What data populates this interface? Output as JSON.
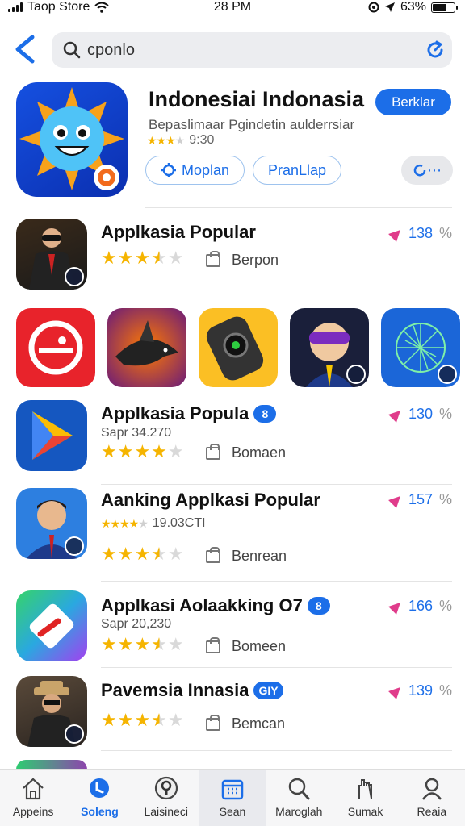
{
  "status_bar": {
    "carrier": "Taop Store",
    "time": "28 PM",
    "battery": "63%"
  },
  "search": {
    "query": "cponlo"
  },
  "featured": {
    "title": "Indonesiai Indonasia",
    "subtitle": "Bepaslimaar Pgindetin aulderrsiar",
    "stars_filled": 3,
    "rating_text": "9:30",
    "get_label": "Berklar",
    "pill1_label": "Moplan",
    "pill2_label": "PranLlap",
    "more_label": "⋯"
  },
  "apps": [
    {
      "name": "Applkasia Popular",
      "badge": "",
      "meta": "",
      "stars_filled": 3.5,
      "category": "Berpon",
      "percent": "138",
      "percent_symbol": "%"
    },
    {
      "name": "Applkasia Popula",
      "badge": "8",
      "meta": "Sapr 34.270",
      "stars_filled": 4,
      "category": "Bomaen",
      "percent": "130",
      "percent_symbol": "%"
    },
    {
      "name": "Aanking Applkasi Popular",
      "badge": "",
      "meta": "19.03CTI",
      "stars_filled": 3.5,
      "category": "Benrean",
      "percent": "157",
      "percent_symbol": "%"
    },
    {
      "name": "Applkasi Aolaakking O7",
      "badge": "8",
      "meta": "Sapr 20,230",
      "stars_filled": 3.5,
      "category": "Bomeen",
      "percent": "166",
      "percent_symbol": "%"
    },
    {
      "name": "Pavemsia Innasia",
      "badge": "GIY",
      "meta": "",
      "stars_filled": 3.5,
      "category": "Bemcan",
      "percent": "139",
      "percent_symbol": "%"
    }
  ],
  "carousel": [
    {
      "icon": "target-icon"
    },
    {
      "icon": "shark-icon"
    },
    {
      "icon": "camera-icon"
    },
    {
      "icon": "cartoon-face-icon"
    },
    {
      "icon": "network-globe-icon"
    }
  ],
  "tabs": [
    {
      "label": "Appeins",
      "icon": "home-icon",
      "active": false
    },
    {
      "label": "Soleng",
      "icon": "search-circle-icon",
      "active": true
    },
    {
      "label": "Laisineci",
      "icon": "coin-icon",
      "active": false
    },
    {
      "label": "Sean",
      "icon": "calendar-icon",
      "active": false
    },
    {
      "label": "Maroglah",
      "icon": "magnifier-icon",
      "active": false
    },
    {
      "label": "Sumak",
      "icon": "hand-icon",
      "active": false
    },
    {
      "label": "Reaia",
      "icon": "person-icon",
      "active": false
    }
  ],
  "colors": {
    "accent": "#1c6ee8",
    "star": "#f5b400",
    "star_off": "#d9d9d9"
  }
}
